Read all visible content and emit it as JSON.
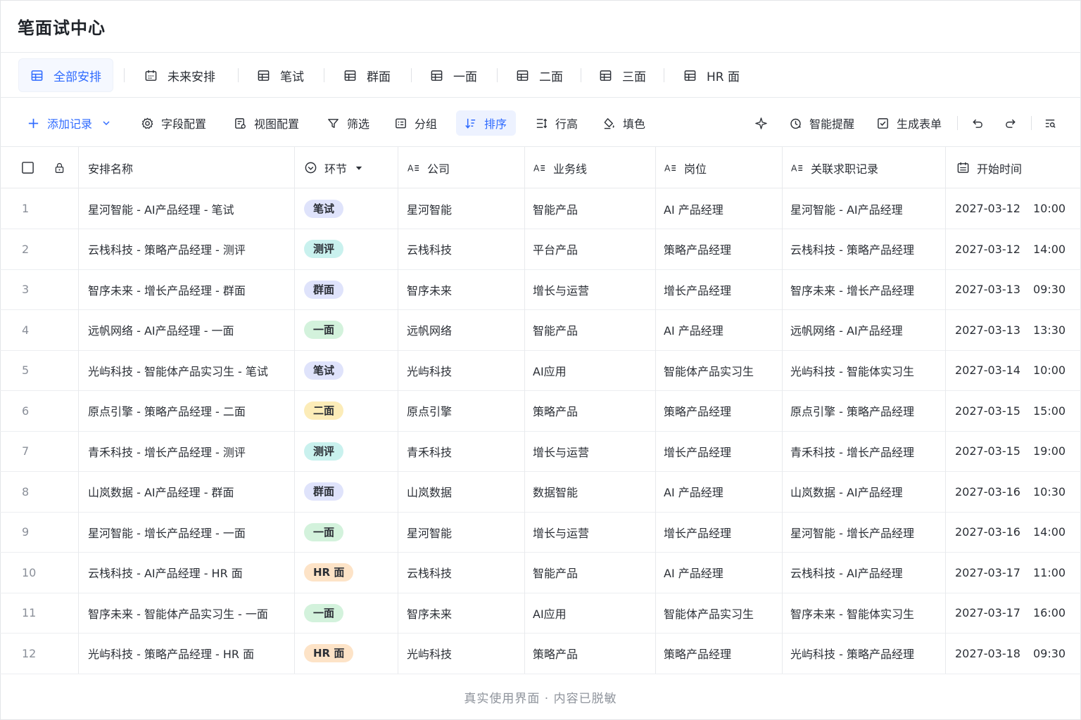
{
  "page_title": "笔面试中心",
  "tabs": [
    {
      "label": "全部安排",
      "icon": "table-icon",
      "active": true
    },
    {
      "label": "未来安排",
      "icon": "calendar-icon",
      "active": false
    },
    {
      "label": "笔试",
      "icon": "table-icon",
      "active": false
    },
    {
      "label": "群面",
      "icon": "table-icon",
      "active": false
    },
    {
      "label": "一面",
      "icon": "table-icon",
      "active": false
    },
    {
      "label": "二面",
      "icon": "table-icon",
      "active": false
    },
    {
      "label": "三面",
      "icon": "table-icon",
      "active": false
    },
    {
      "label": "HR 面",
      "icon": "table-icon",
      "active": false
    }
  ],
  "toolbar": {
    "add_record": "添加记录",
    "field_config": "字段配置",
    "view_config": "视图配置",
    "filter": "筛选",
    "group": "分组",
    "sort": "排序",
    "row_height": "行高",
    "fill_color": "填色",
    "smart_reminder": "智能提醒",
    "generate_form": "生成表单"
  },
  "columns": {
    "name": "安排名称",
    "stage": "环节",
    "company": "公司",
    "business_line": "业务线",
    "position": "岗位",
    "related_record": "关联求职记录",
    "start_time": "开始时间"
  },
  "tag_colors": {
    "笔试": "#dfe3fb",
    "测评": "#c9f1ee",
    "群面": "#dfe3fb",
    "一面": "#d3f2dc",
    "二面": "#fcecb8",
    "HR 面": "#fde3c7"
  },
  "rows": [
    {
      "num": "1",
      "name": "星河智能 - AI产品经理 - 笔试",
      "stage": "笔试",
      "company": "星河智能",
      "line": "智能产品",
      "position": "AI 产品经理",
      "related": "星河智能 - AI产品经理",
      "date": "2027-03-12",
      "time": "10:00"
    },
    {
      "num": "2",
      "name": "云栈科技 - 策略产品经理 - 测评",
      "stage": "测评",
      "company": "云栈科技",
      "line": "平台产品",
      "position": "策略产品经理",
      "related": "云栈科技 - 策略产品经理",
      "date": "2027-03-12",
      "time": "14:00"
    },
    {
      "num": "3",
      "name": "智序未来 - 增长产品经理 - 群面",
      "stage": "群面",
      "company": "智序未来",
      "line": "增长与运营",
      "position": "增长产品经理",
      "related": "智序未来 - 增长产品经理",
      "date": "2027-03-13",
      "time": "09:30"
    },
    {
      "num": "4",
      "name": "远帆网络 - AI产品经理 - 一面",
      "stage": "一面",
      "company": "远帆网络",
      "line": "智能产品",
      "position": "AI 产品经理",
      "related": "远帆网络 - AI产品经理",
      "date": "2027-03-13",
      "time": "13:30"
    },
    {
      "num": "5",
      "name": "光屿科技 - 智能体产品实习生 - 笔试",
      "stage": "笔试",
      "company": "光屿科技",
      "line": "AI应用",
      "position": "智能体产品实习生",
      "related": "光屿科技 - 智能体实习生",
      "date": "2027-03-14",
      "time": "10:00"
    },
    {
      "num": "6",
      "name": "原点引擎 - 策略产品经理 - 二面",
      "stage": "二面",
      "company": "原点引擎",
      "line": "策略产品",
      "position": "策略产品经理",
      "related": "原点引擎 - 策略产品经理",
      "date": "2027-03-15",
      "time": "15:00"
    },
    {
      "num": "7",
      "name": "青禾科技 - 增长产品经理 - 测评",
      "stage": "测评",
      "company": "青禾科技",
      "line": "增长与运营",
      "position": "增长产品经理",
      "related": "青禾科技 - 增长产品经理",
      "date": "2027-03-15",
      "time": "19:00"
    },
    {
      "num": "8",
      "name": "山岚数据 - AI产品经理 - 群面",
      "stage": "群面",
      "company": "山岚数据",
      "line": "数据智能",
      "position": "AI 产品经理",
      "related": "山岚数据 - AI产品经理",
      "date": "2027-03-16",
      "time": "10:30"
    },
    {
      "num": "9",
      "name": "星河智能 - 增长产品经理 - 一面",
      "stage": "一面",
      "company": "星河智能",
      "line": "增长与运营",
      "position": "增长产品经理",
      "related": "星河智能 - 增长产品经理",
      "date": "2027-03-16",
      "time": "14:00"
    },
    {
      "num": "10",
      "name": "云栈科技 - AI产品经理 - HR 面",
      "stage": "HR 面",
      "company": "云栈科技",
      "line": "智能产品",
      "position": "AI 产品经理",
      "related": "云栈科技 - AI产品经理",
      "date": "2027-03-17",
      "time": "11:00"
    },
    {
      "num": "11",
      "name": "智序未来 - 智能体产品实习生 - 一面",
      "stage": "一面",
      "company": "智序未来",
      "line": "AI应用",
      "position": "智能体产品实习生",
      "related": "智序未来 - 智能体实习生",
      "date": "2027-03-17",
      "time": "16:00"
    },
    {
      "num": "12",
      "name": "光屿科技 - 策略产品经理 - HR 面",
      "stage": "HR 面",
      "company": "光屿科技",
      "line": "策略产品",
      "position": "策略产品经理",
      "related": "光屿科技 - 策略产品经理",
      "date": "2027-03-18",
      "time": "09:30"
    }
  ],
  "footer": "真实使用界面 · 内容已脱敏"
}
